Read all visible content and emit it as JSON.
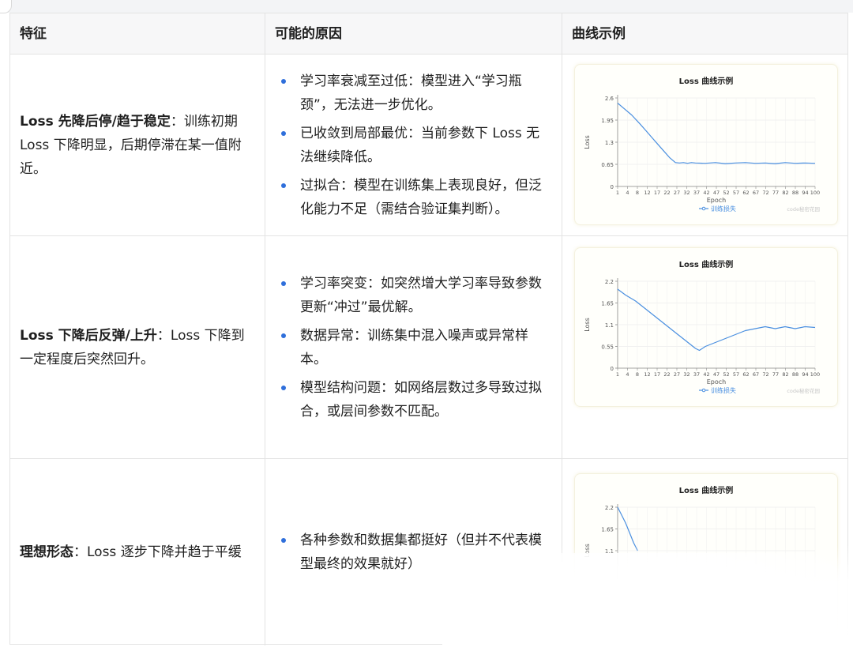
{
  "table": {
    "headers": [
      "特征",
      "可能的原因",
      "曲线示例"
    ],
    "rows": [
      {
        "feature_bold": "Loss 先降后停/趋于稳定",
        "feature_rest": "：训练初期 Loss 下降明显，后期停滞在某一值附近。",
        "reasons": [
          "学习率衰减至过低：模型进入“学习瓶颈”，无法进一步优化。",
          "已收敛到局部最优：当前参数下 Loss 无法继续降低。",
          "过拟合：模型在训练集上表现良好，但泛化能力不足（需结合验证集判断）。"
        ]
      },
      {
        "feature_bold": "Loss 下降后反弹/上升",
        "feature_rest": "：Loss 下降到一定程度后突然回升。",
        "reasons": [
          "学习率突变：如突然增大学习率导致参数更新“冲过”最优解。",
          "数据异常：训练集中混入噪声或异常样本。",
          "模型结构问题：如网络层数过多导致过拟合，或层间参数不匹配。"
        ]
      },
      {
        "feature_bold": "理想形态",
        "feature_rest": "：Loss 逐步下降并趋于平缓",
        "reasons": [
          "各种参数和数据集都挺好（但并不代表模型最终的效果就好）"
        ]
      }
    ]
  },
  "chart_data": [
    {
      "type": "line",
      "title": "Loss 曲线示例",
      "xlabel": "Epoch",
      "ylabel": "Loss",
      "ylim": [
        0,
        2.6
      ],
      "yticks": [
        "0",
        "0.65",
        "1.3",
        "1.95",
        "2.6"
      ],
      "xticks": [
        "1",
        "4",
        "8",
        "12",
        "17",
        "22",
        "27",
        "32",
        "37",
        "42",
        "47",
        "52",
        "57",
        "62",
        "67",
        "72",
        "77",
        "82",
        "88",
        "94",
        "100"
      ],
      "legend": "训练损失",
      "watermark": "code秘密花园",
      "series": [
        {
          "name": "训练损失",
          "color": "#4a8fe0",
          "x": [
            1,
            4,
            8,
            12,
            15,
            18,
            21,
            24,
            27,
            29,
            30,
            32,
            34,
            36,
            38,
            40,
            45,
            50,
            55,
            60,
            65,
            70,
            75,
            80,
            85,
            90,
            95,
            100
          ],
          "y": [
            2.45,
            2.3,
            2.1,
            1.85,
            1.65,
            1.45,
            1.25,
            1.05,
            0.85,
            0.75,
            0.7,
            0.69,
            0.7,
            0.68,
            0.7,
            0.69,
            0.68,
            0.7,
            0.67,
            0.69,
            0.7,
            0.68,
            0.69,
            0.67,
            0.7,
            0.68,
            0.69,
            0.68
          ]
        }
      ]
    },
    {
      "type": "line",
      "title": "Loss 曲线示例",
      "xlabel": "Epoch",
      "ylabel": "Loss",
      "ylim": [
        0,
        2.2
      ],
      "yticks": [
        "0",
        "0.55",
        "1.1",
        "1.65",
        "2.2"
      ],
      "xticks": [
        "1",
        "4",
        "8",
        "12",
        "17",
        "22",
        "27",
        "32",
        "37",
        "42",
        "47",
        "52",
        "57",
        "62",
        "67",
        "72",
        "77",
        "82",
        "88",
        "94",
        "100"
      ],
      "legend": "训练损失",
      "watermark": "code秘密花园",
      "series": [
        {
          "name": "训练损失",
          "color": "#4a8fe0",
          "x": [
            1,
            5,
            10,
            15,
            20,
            25,
            30,
            35,
            40,
            42,
            45,
            50,
            55,
            60,
            65,
            70,
            75,
            80,
            85,
            90,
            95,
            100
          ],
          "y": [
            2.0,
            1.85,
            1.7,
            1.5,
            1.3,
            1.1,
            0.9,
            0.7,
            0.5,
            0.45,
            0.55,
            0.65,
            0.75,
            0.85,
            0.95,
            1.0,
            1.05,
            1.0,
            1.05,
            1.0,
            1.05,
            1.03
          ]
        }
      ]
    },
    {
      "type": "line",
      "title": "Loss 曲线示例",
      "ylabel": "Loss",
      "ylim": [
        0,
        2.2
      ],
      "yticks": [
        "2.2",
        "1.65",
        "1.1"
      ],
      "series": [
        {
          "name": "训练损失",
          "color": "#4a8fe0",
          "x": [
            1,
            3,
            5,
            7,
            9,
            11
          ],
          "y": [
            2.2,
            2.0,
            1.8,
            1.55,
            1.3,
            1.1
          ]
        }
      ]
    }
  ]
}
